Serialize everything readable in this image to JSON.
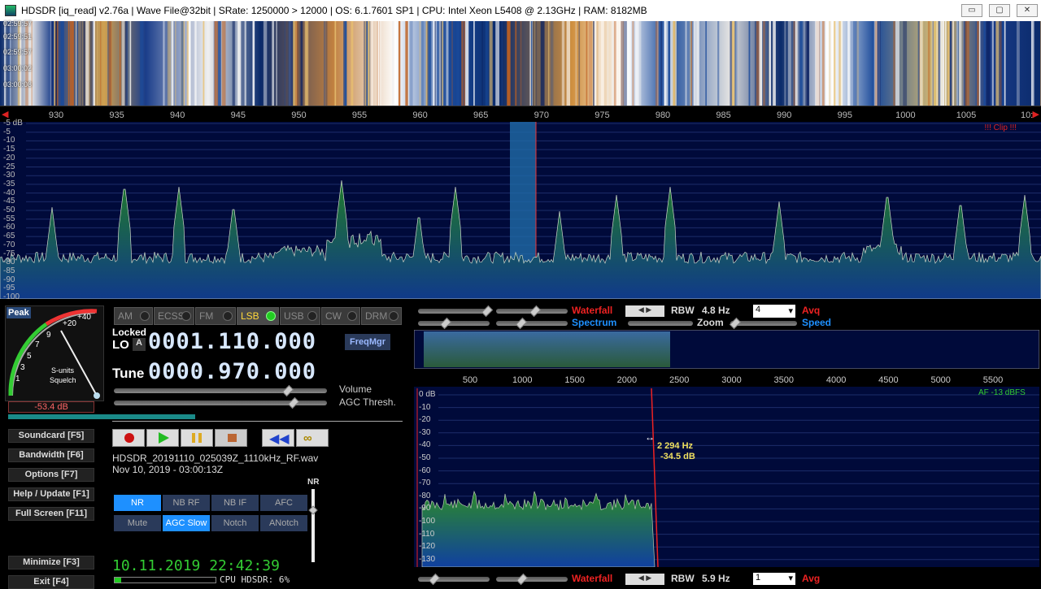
{
  "titlebar": {
    "text": "HDSDR  [iq_read]  v2.76a  |  Wave File@32bit  |  SRate: 1250000 > 12000  |  OS: 6.1.7601 SP1  |  CPU: Intel Xeon         L5408  @ 2.13GHz  |  RAM: 8182MB",
    "min": "▭",
    "max": "▢",
    "close": "✕"
  },
  "waterfall_times": [
    "02:59:57",
    "02:59:51",
    "02:59:57",
    "03:00:02",
    "03:00:08"
  ],
  "freq_axis": [
    "930",
    "935",
    "940",
    "945",
    "950",
    "955",
    "960",
    "965",
    "970",
    "975",
    "980",
    "985",
    "990",
    "995",
    "1000",
    "1005",
    "10:"
  ],
  "db_axis": [
    "-5 dB",
    "-5",
    "-10",
    "-15",
    "-20",
    "-25",
    "-30",
    "-35",
    "-40",
    "-45",
    "-50",
    "-55",
    "-60",
    "-65",
    "-70",
    "-75",
    "-80",
    "-85",
    "-90",
    "-95",
    "-100"
  ],
  "clip_text": "!!! Clip !!!",
  "smeter": {
    "peak": "Peak",
    "labels": [
      "+40",
      "+20",
      "9",
      "7",
      "5",
      "3",
      "1"
    ],
    "title1": "S-units",
    "title2": "Squelch",
    "reading": "-53.4 dB"
  },
  "modes": [
    {
      "label": "AM",
      "on": false
    },
    {
      "label": "ECSS",
      "on": false
    },
    {
      "label": "FM",
      "on": false
    },
    {
      "label": "LSB",
      "on": true
    },
    {
      "label": "USB",
      "on": false
    },
    {
      "label": "CW",
      "on": false
    },
    {
      "label": "DRM",
      "on": false
    }
  ],
  "freq": {
    "locked": "Locked",
    "lo_label": "LO",
    "lo_a": "A",
    "lo_value": "0001.110.000",
    "tune_label": "Tune",
    "tune_value": "0000.970.000",
    "freqmgr": "FreqMgr"
  },
  "sliders": {
    "volume": "Volume",
    "agc": "AGC Thresh."
  },
  "side_buttons": [
    "Soundcard  [F5]",
    "Bandwidth  [F6]",
    "Options  [F7]",
    "Help / Update  [F1]",
    "Full Screen  [F11]",
    "Minimize  [F3]",
    "Exit  [F4]"
  ],
  "file": {
    "name": "HDSDR_20191110_025039Z_1110kHz_RF.wav",
    "date": "Nov 10, 2019 - 03:00:13Z"
  },
  "nr_label": "NR",
  "dsp_buttons": [
    {
      "label": "NR",
      "on": true
    },
    {
      "label": "NB RF",
      "on": false
    },
    {
      "label": "NB IF",
      "on": false
    },
    {
      "label": "AFC",
      "on": false
    },
    {
      "label": "Mute",
      "on": false
    },
    {
      "label": "AGC Slow",
      "on": true
    },
    {
      "label": "Notch",
      "on": false
    },
    {
      "label": "ANotch",
      "on": false
    }
  ],
  "clock": "10.11.2019 22:42:39",
  "cpu": "CPU HDSDR:  6%",
  "audio": {
    "waterfall": "Waterfall",
    "spectrum": "Spectrum",
    "rbw_label": "RBW",
    "rbw_value": "4.8 Hz",
    "avg_value": "4",
    "avg": "Avq",
    "zoom": "Zoom",
    "speed": "Speed",
    "axis": [
      "500",
      "1000",
      "1500",
      "2000",
      "2500",
      "3000",
      "3500",
      "4000",
      "4500",
      "5000",
      "5500"
    ],
    "af_level": "AF -13 dBFS",
    "db": [
      "0 dB",
      "-10",
      "-20",
      "-30",
      "-40",
      "-50",
      "-60",
      "-70",
      "-80",
      "-90",
      "-100",
      "-110",
      "-120",
      "-130"
    ],
    "cursor_hz": "2 294 Hz",
    "cursor_db": "-34.5 dB",
    "bottom": {
      "waterfall": "Waterfall",
      "rbw_label": "RBW",
      "rbw_value": "5.9 Hz",
      "avg_value": "1",
      "avg": "Avg"
    }
  }
}
